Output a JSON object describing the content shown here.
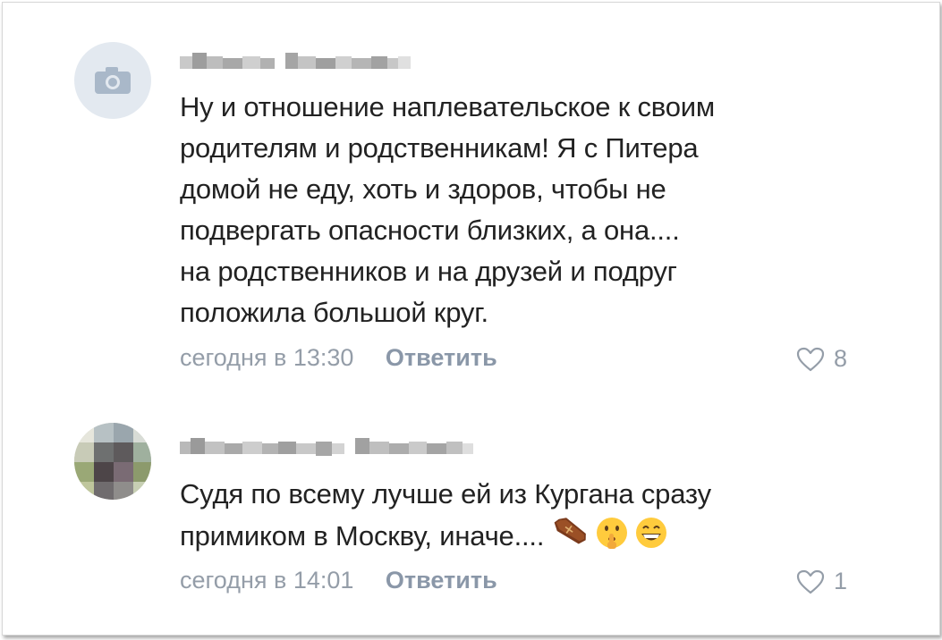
{
  "comments": [
    {
      "avatar": "camera-placeholder-icon",
      "text_lines": [
        "Ну и отношение наплевательское к своим",
        "родителям и родственникам! Я с Питера",
        "домой не еду, хоть и здоров, чтобы не",
        "подвергать опасности близких, а она....",
        "на родственников и на друзей и подруг",
        "положила большой круг."
      ],
      "time": "сегодня в 13:30",
      "reply_label": "Ответить",
      "likes": "8"
    },
    {
      "avatar": "pixelated-photo",
      "text_lines": [
        "Судя по всему лучше ей из Кургана сразу",
        "примиком в Москву, иначе...."
      ],
      "emojis": [
        "coffin-icon",
        "shushing-face-icon",
        "grinning-face-icon"
      ],
      "time": "сегодня в 14:01",
      "reply_label": "Ответить",
      "likes": "1"
    }
  ],
  "colors": {
    "text": "#222222",
    "meta": "#949da8",
    "reply": "#8a97a8",
    "avatar_placeholder": "#e3e9f0",
    "camera_icon": "#a9b8c9"
  }
}
